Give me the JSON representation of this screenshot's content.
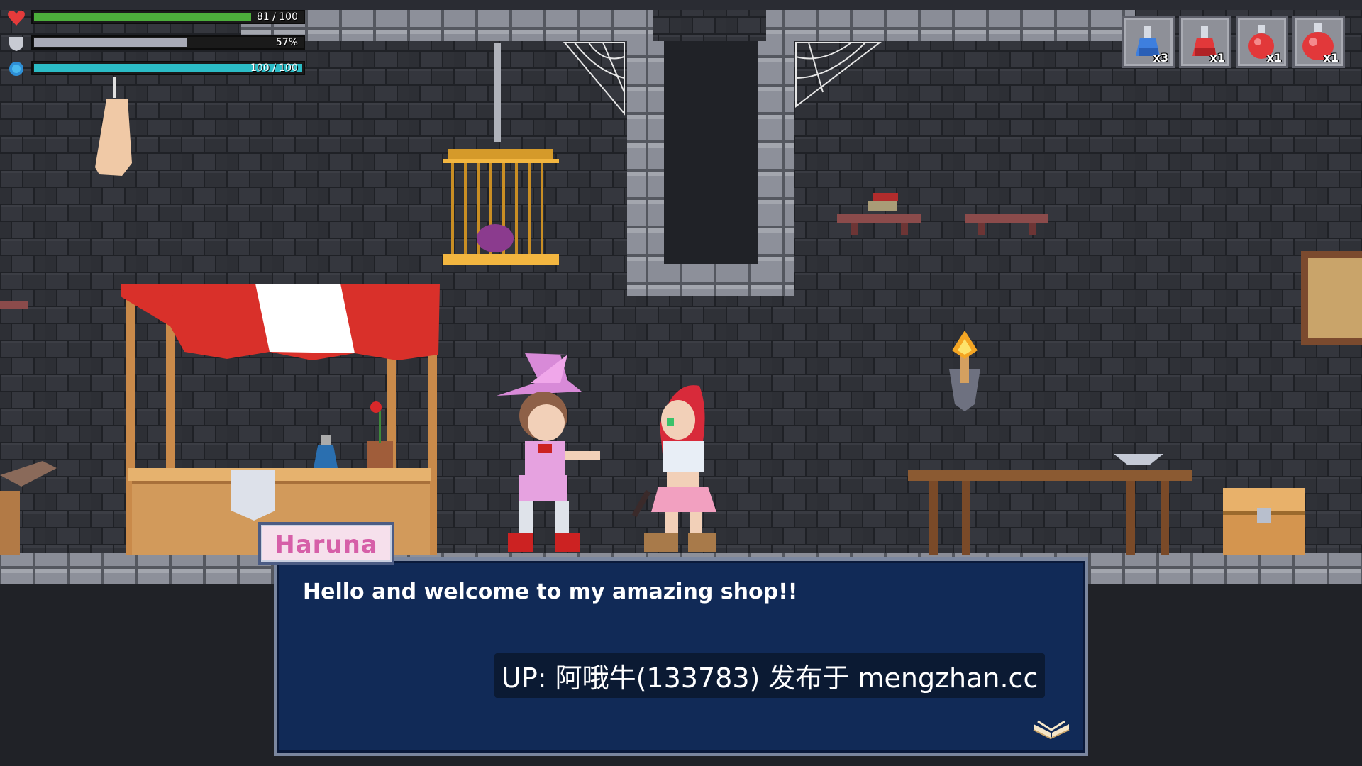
{
  "hud": {
    "health": {
      "value": 81,
      "max": 100,
      "label": "81 / 100",
      "icon": "heart-icon",
      "color": "#4cae3b"
    },
    "armor": {
      "percent": 57,
      "label": "57%",
      "icon": "shield-icon",
      "color": "#a8aab6"
    },
    "mana": {
      "value": 100,
      "max": 100,
      "label": "100 / 100",
      "icon": "mana-orb-icon",
      "color": "#2bbcc6"
    }
  },
  "inventory": {
    "potions": [
      {
        "icon": "small-blue-potion-icon",
        "count": "x3"
      },
      {
        "icon": "small-red-potion-icon",
        "count": "x1"
      },
      {
        "icon": "medium-red-potion-icon",
        "count": "x1"
      },
      {
        "icon": "large-red-potion-icon",
        "count": "x1"
      }
    ]
  },
  "dialog": {
    "speaker": "Haruna",
    "text": "Hello and welcome to my amazing shop!!",
    "watermark": "UP: 阿哦牛(133783) 发布于 mengzhan.cc",
    "advance_icon": "open-book-icon"
  },
  "colors": {
    "speaker_name": "#d65fa8",
    "dialog_bg": "#112a57",
    "brick_dark": "#303238",
    "stone_light": "#8d909a"
  }
}
